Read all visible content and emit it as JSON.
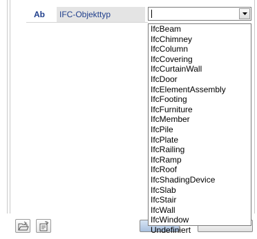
{
  "property": {
    "code": "Ab",
    "label": "IFC-Objekttyp"
  },
  "combo": {
    "value": "",
    "dropdown_icon": "chevron-down-icon"
  },
  "dropdown_options": [
    "IfcBeam",
    "IfcChimney",
    "IfcColumn",
    "IfcCovering",
    "IfcCurtainWall",
    "IfcDoor",
    "IfcElementAssembly",
    "IfcFooting",
    "IfcFurniture",
    "IfcMember",
    "IfcPile",
    "IfcPlate",
    "IfcRailing",
    "IfcRamp",
    "IfcRoof",
    "IfcShadingDevice",
    "IfcSlab",
    "IfcStair",
    "IfcWall",
    "IfcWindow",
    "Undefiniert"
  ],
  "toolbar_icons": {
    "left": "open-folder-icon",
    "right": "edit-properties-icon"
  },
  "colors": {
    "label_text": "#1f3e8c",
    "label_bg": "#e4e4e4"
  }
}
